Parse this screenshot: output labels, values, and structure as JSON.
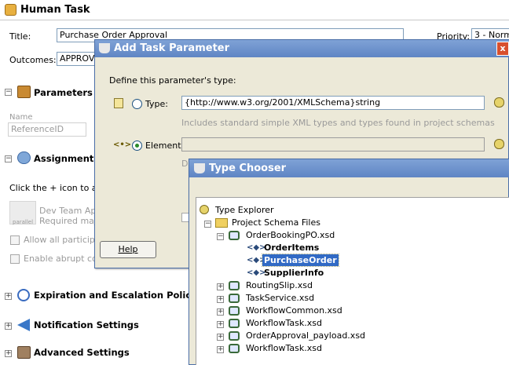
{
  "header": {
    "title": "Human Task"
  },
  "general": {
    "title_label": "Title:",
    "title_value": "Purchase Order Approval",
    "outcomes_label": "Outcomes:",
    "outcomes_value": "APPROVE",
    "priority_label": "Priority:",
    "priority_value": "3 - Norm"
  },
  "parameters": {
    "title": "Parameters",
    "name_header": "Name",
    "name_value": "ReferenceID"
  },
  "assignment": {
    "title": "Assignment a",
    "hint": "Click the + icon to add",
    "participant_line1": "Dev Team App",
    "participant_line2": "Required majo",
    "participant_badge": "parallel",
    "allow_all": "Allow all participant",
    "enable_abrupt": "Enable abrupt com"
  },
  "sections": {
    "expiration": "Expiration and Escalation Policy",
    "notification": "Notification Settings",
    "advanced": "Advanced Settings"
  },
  "add_dialog": {
    "title": "Add Task Parameter",
    "prompt": "Define this parameter's type:",
    "type_label": "Type:",
    "type_value": "{http://www.w3.org/2001/XMLSchema}string",
    "type_hint": "Includes standard simple XML types and types found in project schemas",
    "element_label": "Element:",
    "element_value": "",
    "element_hint_partial": "D",
    "help_button": "Help"
  },
  "chooser": {
    "title": "Type Chooser",
    "tree": [
      {
        "label": "Type Explorer"
      },
      {
        "label": "Project Schema Files"
      },
      {
        "label": "OrderBookingPO.xsd"
      },
      {
        "label": "OrderItems"
      },
      {
        "label": "PurchaseOrder",
        "selected": true
      },
      {
        "label": "SupplierInfo"
      },
      {
        "label": "RoutingSlip.xsd"
      },
      {
        "label": "TaskService.xsd"
      },
      {
        "label": "WorkflowCommon.xsd"
      },
      {
        "label": "WorkflowTask.xsd"
      },
      {
        "label": "OrderApproval_payload.xsd"
      },
      {
        "label": "WorkflowTask.xsd"
      }
    ]
  },
  "colors": {
    "titlebar": "#6b8fcb",
    "selection": "#316ac5",
    "section_icon_orange": "#d08a2a"
  }
}
